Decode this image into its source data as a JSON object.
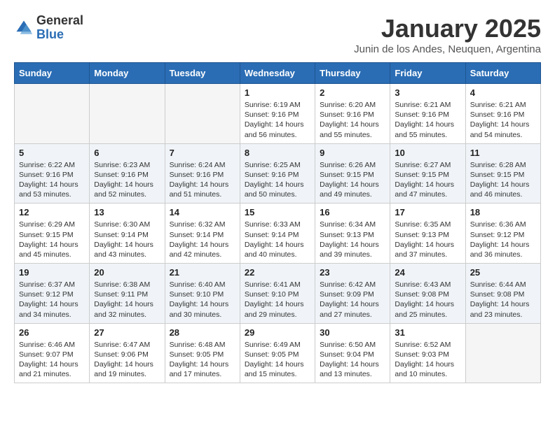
{
  "logo": {
    "general": "General",
    "blue": "Blue"
  },
  "title": "January 2025",
  "location": "Junin de los Andes, Neuquen, Argentina",
  "days_of_week": [
    "Sunday",
    "Monday",
    "Tuesday",
    "Wednesday",
    "Thursday",
    "Friday",
    "Saturday"
  ],
  "weeks": [
    {
      "shaded": false,
      "days": [
        {
          "num": "",
          "info": ""
        },
        {
          "num": "",
          "info": ""
        },
        {
          "num": "",
          "info": ""
        },
        {
          "num": "1",
          "info": "Sunrise: 6:19 AM\nSunset: 9:16 PM\nDaylight: 14 hours\nand 56 minutes."
        },
        {
          "num": "2",
          "info": "Sunrise: 6:20 AM\nSunset: 9:16 PM\nDaylight: 14 hours\nand 55 minutes."
        },
        {
          "num": "3",
          "info": "Sunrise: 6:21 AM\nSunset: 9:16 PM\nDaylight: 14 hours\nand 55 minutes."
        },
        {
          "num": "4",
          "info": "Sunrise: 6:21 AM\nSunset: 9:16 PM\nDaylight: 14 hours\nand 54 minutes."
        }
      ]
    },
    {
      "shaded": true,
      "days": [
        {
          "num": "5",
          "info": "Sunrise: 6:22 AM\nSunset: 9:16 PM\nDaylight: 14 hours\nand 53 minutes."
        },
        {
          "num": "6",
          "info": "Sunrise: 6:23 AM\nSunset: 9:16 PM\nDaylight: 14 hours\nand 52 minutes."
        },
        {
          "num": "7",
          "info": "Sunrise: 6:24 AM\nSunset: 9:16 PM\nDaylight: 14 hours\nand 51 minutes."
        },
        {
          "num": "8",
          "info": "Sunrise: 6:25 AM\nSunset: 9:16 PM\nDaylight: 14 hours\nand 50 minutes."
        },
        {
          "num": "9",
          "info": "Sunrise: 6:26 AM\nSunset: 9:15 PM\nDaylight: 14 hours\nand 49 minutes."
        },
        {
          "num": "10",
          "info": "Sunrise: 6:27 AM\nSunset: 9:15 PM\nDaylight: 14 hours\nand 47 minutes."
        },
        {
          "num": "11",
          "info": "Sunrise: 6:28 AM\nSunset: 9:15 PM\nDaylight: 14 hours\nand 46 minutes."
        }
      ]
    },
    {
      "shaded": false,
      "days": [
        {
          "num": "12",
          "info": "Sunrise: 6:29 AM\nSunset: 9:15 PM\nDaylight: 14 hours\nand 45 minutes."
        },
        {
          "num": "13",
          "info": "Sunrise: 6:30 AM\nSunset: 9:14 PM\nDaylight: 14 hours\nand 43 minutes."
        },
        {
          "num": "14",
          "info": "Sunrise: 6:32 AM\nSunset: 9:14 PM\nDaylight: 14 hours\nand 42 minutes."
        },
        {
          "num": "15",
          "info": "Sunrise: 6:33 AM\nSunset: 9:14 PM\nDaylight: 14 hours\nand 40 minutes."
        },
        {
          "num": "16",
          "info": "Sunrise: 6:34 AM\nSunset: 9:13 PM\nDaylight: 14 hours\nand 39 minutes."
        },
        {
          "num": "17",
          "info": "Sunrise: 6:35 AM\nSunset: 9:13 PM\nDaylight: 14 hours\nand 37 minutes."
        },
        {
          "num": "18",
          "info": "Sunrise: 6:36 AM\nSunset: 9:12 PM\nDaylight: 14 hours\nand 36 minutes."
        }
      ]
    },
    {
      "shaded": true,
      "days": [
        {
          "num": "19",
          "info": "Sunrise: 6:37 AM\nSunset: 9:12 PM\nDaylight: 14 hours\nand 34 minutes."
        },
        {
          "num": "20",
          "info": "Sunrise: 6:38 AM\nSunset: 9:11 PM\nDaylight: 14 hours\nand 32 minutes."
        },
        {
          "num": "21",
          "info": "Sunrise: 6:40 AM\nSunset: 9:10 PM\nDaylight: 14 hours\nand 30 minutes."
        },
        {
          "num": "22",
          "info": "Sunrise: 6:41 AM\nSunset: 9:10 PM\nDaylight: 14 hours\nand 29 minutes."
        },
        {
          "num": "23",
          "info": "Sunrise: 6:42 AM\nSunset: 9:09 PM\nDaylight: 14 hours\nand 27 minutes."
        },
        {
          "num": "24",
          "info": "Sunrise: 6:43 AM\nSunset: 9:08 PM\nDaylight: 14 hours\nand 25 minutes."
        },
        {
          "num": "25",
          "info": "Sunrise: 6:44 AM\nSunset: 9:08 PM\nDaylight: 14 hours\nand 23 minutes."
        }
      ]
    },
    {
      "shaded": false,
      "days": [
        {
          "num": "26",
          "info": "Sunrise: 6:46 AM\nSunset: 9:07 PM\nDaylight: 14 hours\nand 21 minutes."
        },
        {
          "num": "27",
          "info": "Sunrise: 6:47 AM\nSunset: 9:06 PM\nDaylight: 14 hours\nand 19 minutes."
        },
        {
          "num": "28",
          "info": "Sunrise: 6:48 AM\nSunset: 9:05 PM\nDaylight: 14 hours\nand 17 minutes."
        },
        {
          "num": "29",
          "info": "Sunrise: 6:49 AM\nSunset: 9:05 PM\nDaylight: 14 hours\nand 15 minutes."
        },
        {
          "num": "30",
          "info": "Sunrise: 6:50 AM\nSunset: 9:04 PM\nDaylight: 14 hours\nand 13 minutes."
        },
        {
          "num": "31",
          "info": "Sunrise: 6:52 AM\nSunset: 9:03 PM\nDaylight: 14 hours\nand 10 minutes."
        },
        {
          "num": "",
          "info": ""
        }
      ]
    }
  ]
}
